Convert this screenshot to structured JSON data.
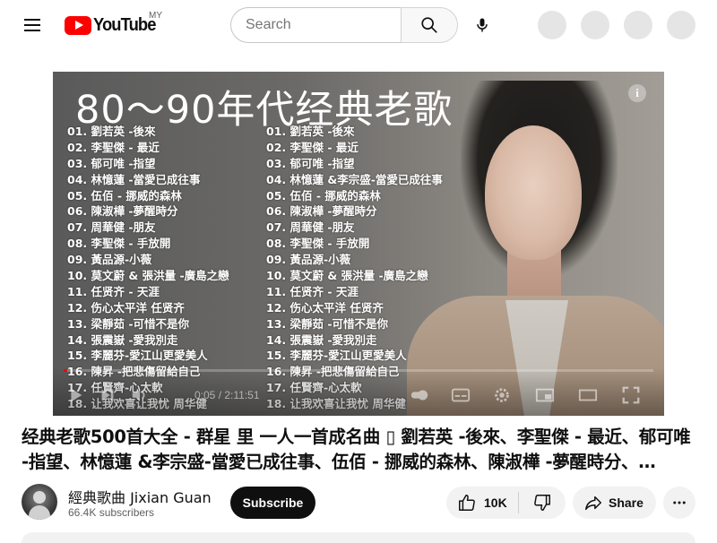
{
  "header": {
    "logo_text": "YouTube",
    "country_code": "MY",
    "search_placeholder": "Search",
    "icons": [
      "menu-icon",
      "search-icon",
      "mic-icon"
    ]
  },
  "player": {
    "thumbnail_title": "80～90年代经典老歌",
    "songs_left": [
      "01. 劉若英 -後來",
      "02. 李聖傑 - 最近",
      "03. 郁可唯 -指望",
      "04. 林憶蓮 -當愛已成往事",
      "05. 伍佰 - 挪威的森林",
      "06. 陳淑樺 -夢醒時分",
      "07. 周華健 -朋友",
      "08. 李聖傑 - 手放開",
      "09. 黃品源-小薇",
      "10. 莫文蔚 & 張洪量 -廣島之戀",
      "11. 任贤齐 - 天涯",
      "12. 伤心太平洋 任贤齐",
      "13. 梁靜茹 -可惜不是你",
      "14. 張震嶽 -愛我別走",
      "15. 李麗芬-愛江山更愛美人",
      "16. 陳昇 -把悲傷留給自己",
      "17. 任賢齊-心太軟",
      "18. 让我欢喜让我忧 周华健"
    ],
    "songs_right": [
      "01. 劉若英 -後來",
      "02. 李聖傑 - 最近",
      "03. 郁可唯 -指望",
      "04. 林憶蓮 &李宗盛-當愛已成往事",
      "05. 伍佰 - 挪威的森林",
      "06. 陳淑樺 -夢醒時分",
      "07. 周華健 -朋友",
      "08. 李聖傑 - 手放開",
      "09. 黃品源-小薇",
      "10. 莫文蔚 & 張洪量 -廣島之戀",
      "11. 任贤齐 - 天涯",
      "12. 伤心太平洋 任贤齐",
      "13. 梁靜茹 -可惜不是你",
      "14. 張震嶽 -愛我別走",
      "15. 李麗芬-愛江山更愛美人",
      "16. 陳昇 -把悲傷留給自己",
      "17. 任賢齊-心太軟",
      "18. 让我欢喜让我忧 周华健"
    ],
    "time_display": "0:05 / 2:11:51",
    "progress_fraction": 0.0006,
    "progress_color": "#ff0000"
  },
  "video": {
    "title": "经典老歌500首大全 - 群星 里 一人一首成名曲 ▯ 劉若英 -後來、李聖傑 - 最近、郁可唯 -指望、林憶蓮 &李宗盛-當愛已成往事、伍佰 - 挪威的森林、陳淑樺 -夢醒時分、…"
  },
  "channel": {
    "name": "經典歌曲 Jixian Guan",
    "subscribers": "66.4K subscribers",
    "subscribe_label": "Subscribe"
  },
  "actions": {
    "like_count": "10K",
    "share_label": "Share"
  },
  "colors": {
    "brand": "#ff0000",
    "text": "#0f0f0f",
    "secondary_text": "#606060",
    "chip_bg": "#f2f2f2"
  }
}
